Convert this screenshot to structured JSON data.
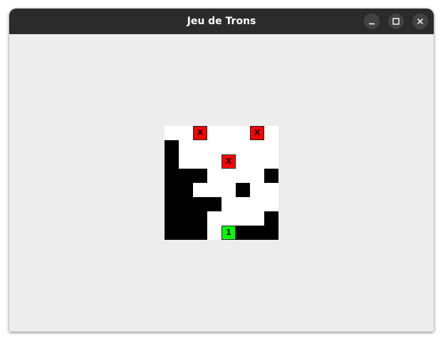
{
  "window": {
    "title": "Jeu de Trons",
    "buttons": {
      "minimize": "–",
      "maximize": "□",
      "close": "✕"
    }
  },
  "board": {
    "cols": 8,
    "rows": 8,
    "colors": {
      "empty": "#ffffff",
      "wall": "#000000",
      "enemy": "#ff0000",
      "player": "#00ff00"
    },
    "legend": {
      ".": "empty",
      "#": "wall",
      "X": "enemy",
      "1": "player"
    },
    "grid": [
      "..X...X.",
      "#.......",
      "#...X...",
      "###....#",
      "##...#..",
      "####....",
      "###....#",
      "###.1###",
      "########"
    ],
    "enemy_label": "X",
    "player_label": "1"
  }
}
